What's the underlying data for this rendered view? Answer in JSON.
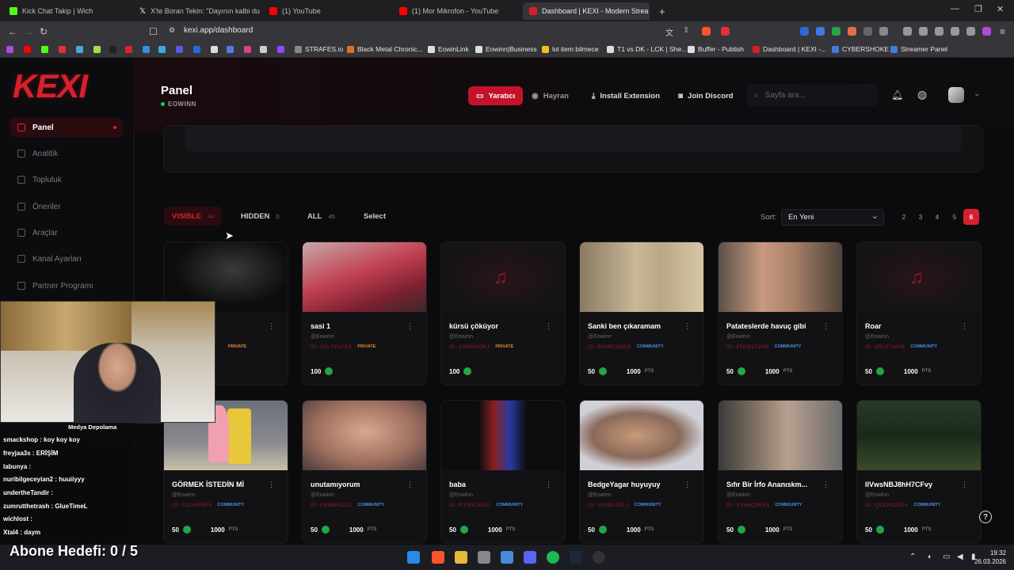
{
  "browser": {
    "tabs": [
      {
        "label": "Kick Chat Takip | Wich",
        "color": "#53fc18"
      },
      {
        "label": "X'te Boran Tekin: \"Dayının kalbi dura",
        "color": "#ffffff"
      },
      {
        "label": "(1) YouTube",
        "color": "#ff0000"
      },
      {
        "label": "(1) Mor Mikrofon - YouTube",
        "color": "#ff0000"
      },
      {
        "label": "Dashboard | KEXI - Modern Strea",
        "color": "#d8202c"
      }
    ],
    "new_tab": "+",
    "url": "kexi.app/dashboard",
    "bookmarks": [
      {
        "label": "STRAFES.io",
        "color": "#888"
      },
      {
        "label": "Black Metal Chronic...",
        "color": "#e07020"
      },
      {
        "label": "EowinLink",
        "color": "#ddd"
      },
      {
        "label": "Eowinn|Business",
        "color": "#ddd"
      },
      {
        "label": "lol item bilmece",
        "color": "#e8c020"
      },
      {
        "label": "T1 vs DK - LCK | She...",
        "color": "#ddd"
      },
      {
        "label": "Buffer - Publish",
        "color": "#ddd"
      },
      {
        "label": "Dashboard | KEXI -...",
        "color": "#d8202c"
      },
      {
        "label": "CYBERSHOKE",
        "color": "#4a7ad8"
      },
      {
        "label": "Streamer Panel",
        "color": "#4a7ad8"
      }
    ]
  },
  "sidebar": {
    "logo": "KEXI",
    "items": [
      {
        "label": "Panel"
      },
      {
        "label": "Analitik"
      },
      {
        "label": "Topluluk"
      },
      {
        "label": "Öneriler"
      },
      {
        "label": "Araçlar"
      },
      {
        "label": "Kanal Ayarları"
      },
      {
        "label": "Partner Programı"
      }
    ]
  },
  "header": {
    "title": "Panel",
    "subtitle": "EOWINN",
    "creator_label": "Yaratıcı",
    "fan_label": "Hayran",
    "install_label": "Install Extension",
    "discord_label": "Join Discord",
    "search_placeholder": "Sayfa ara..."
  },
  "filters": {
    "visible_label": "VISIBLE",
    "visible_count": "44",
    "hidden_label": "HIDDEN",
    "hidden_count": "0",
    "all_label": "ALL",
    "all_count": "45",
    "select_label": "Select",
    "sort_label": "Sort:",
    "sort_value": "En Yeni",
    "pages": [
      "2",
      "3",
      "4",
      "5",
      "6"
    ]
  },
  "cards": [
    {
      "title": "",
      "user": "",
      "id": "",
      "badge": "PRIVATE",
      "points": "100",
      "price": ""
    },
    {
      "title": "sasi 1",
      "user": "@Eowinn",
      "id": "ID: 2AL7YLVSS",
      "badge": "PRIVATE",
      "points": "100",
      "price": ""
    },
    {
      "title": "kürsü çöküyor",
      "user": "@Eowinn",
      "id": "ID: 10FA0H3KJ",
      "badge": "PRIVATE",
      "points": "100",
      "price": ""
    },
    {
      "title": "Sanki ben çıkaramam",
      "user": "@Eowinn",
      "id": "ID: 8H0BCQBK5",
      "badge": "COMMUNITY",
      "points": "50",
      "price": "1000"
    },
    {
      "title": "Patateslerde havuç gibi",
      "user": "@Eowinn",
      "id": "ID: 3TKQ5724M",
      "badge": "COMMUNITY",
      "points": "50",
      "price": "1000"
    },
    {
      "title": "Roar",
      "user": "@Eowinn",
      "id": "ID: 8RL070008",
      "badge": "COMMUNITY",
      "points": "50",
      "price": "1000"
    },
    {
      "title": "GÖRMEK İSTEDİN Mİ",
      "user": "@Eowinn",
      "id": "ID: 2JL54F8R9",
      "badge": "COMMUNITY",
      "points": "50",
      "price": "1000"
    },
    {
      "title": "unutamıyorum",
      "user": "@Eowinn",
      "id": "ID: PK5BR2212",
      "badge": "COMMUNITY",
      "points": "50",
      "price": "1000"
    },
    {
      "title": "baba",
      "user": "@Eowinn",
      "id": "ID: PJ76XJBAC",
      "badge": "COMMUNITY",
      "points": "50",
      "price": "1000"
    },
    {
      "title": "BedgeYagar huyuyuy",
      "user": "@Eowinn",
      "id": "ID: 1H0BSJBLJ",
      "badge": "COMMUNITY",
      "points": "50",
      "price": "1000"
    },
    {
      "title": "Sıfır Bir İrfo Ananıskm...",
      "user": "@Eowinn",
      "id": "ID: YVN6Q0BX5",
      "badge": "COMMUNITY",
      "points": "50",
      "price": "1000"
    },
    {
      "title": "IIVwsNBJ8hH7CFvy",
      "user": "@Eowinn",
      "id": "ID: QECIRDZBA",
      "badge": "COMMUNITY",
      "points": "50",
      "price": "1000"
    }
  ],
  "pts_label": "PTS",
  "overlay": {
    "chat": [
      {
        "text": "Medya Depolama"
      },
      {
        "text": "smackshop : koy koy koy"
      },
      {
        "text": "freyjaa3s : ERİŞİM"
      },
      {
        "text": "labunya :"
      },
      {
        "text": "nuribilgeceyian2 : huuiiyyy"
      },
      {
        "text": "undertheTandir :"
      },
      {
        "text": "zumrutthetrash : GlueTimeL"
      },
      {
        "text": "wichlost :"
      },
      {
        "text": "Xtal4 : daym"
      }
    ],
    "goal": "Abone Hedefi:  0 / 5"
  },
  "taskbar": {
    "time": "19:32",
    "date": "26.03.2026"
  }
}
